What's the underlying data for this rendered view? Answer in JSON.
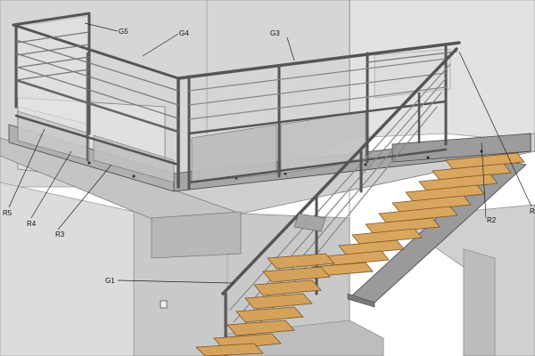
{
  "drawing": {
    "labels": {
      "g1": "G1",
      "g3": "G3",
      "g4": "G4",
      "g5": "G5",
      "r2": "R2",
      "r3": "R3",
      "r4": "R4",
      "r5": "R5",
      "partial_right": "R"
    }
  },
  "colors": {
    "wall": "#d2d2d2",
    "wall_dark": "#bdbdbd",
    "wall_light": "#e3e3e3",
    "slab": "#c8c8c8",
    "steel": "#8e8e8e",
    "steel_dark": "#4a4a4a",
    "glass": "#b9b9b9",
    "tread": "#d4a25a",
    "tread_dark": "#a8742c",
    "leader": "#222222"
  }
}
